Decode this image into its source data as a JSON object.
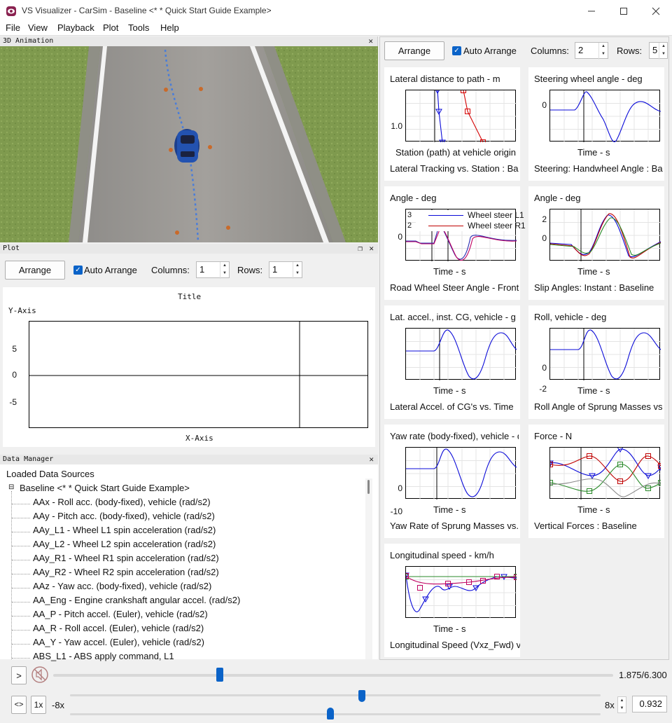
{
  "window": {
    "title": "VS Visualizer - CarSim - Baseline <* * Quick Start Guide Example>",
    "min_icon": "minimize-icon",
    "max_icon": "maximize-icon",
    "close_icon": "close-icon"
  },
  "menu": [
    "File",
    "View",
    "Playback",
    "Plot",
    "Tools",
    "Help"
  ],
  "animation_panel": {
    "header": "3D Animation",
    "close": "✕"
  },
  "plot_panel": {
    "header": "Plot",
    "arrange_label": "Arrange",
    "auto_arrange_label": "Auto Arrange",
    "columns_label": "Columns:",
    "columns_value": "1",
    "rows_label": "Rows:",
    "rows_value": "1",
    "chart_title": "Title",
    "y_axis_label": "Y-Axis",
    "x_axis_label": "X-Axis",
    "y_ticks": [
      "5",
      "0",
      "-5"
    ]
  },
  "data_manager": {
    "header": "Data Manager",
    "root": "Loaded Data Sources",
    "dataset": "Baseline <* * Quick Start Guide Example>",
    "items": [
      "AAx - Roll acc. (body-fixed), vehicle (rad/s2)",
      "AAy - Pitch acc. (body-fixed), vehicle (rad/s2)",
      "AAy_L1 - Wheel L1 spin acceleration (rad/s2)",
      "AAy_L2 - Wheel L2 spin acceleration (rad/s2)",
      "AAy_R1 - Wheel R1 spin acceleration (rad/s2)",
      "AAy_R2 - Wheel R2 spin acceleration (rad/s2)",
      "AAz - Yaw acc. (body-fixed), vehicle (rad/s2)",
      "AA_Eng - Engine crankshaft angular accel. (rad/s2)",
      "AA_P - Pitch accel. (Euler), vehicle (rad/s2)",
      "AA_R - Roll accel. (Euler), vehicle (rad/s2)",
      "AA_Y - Yaw accel. (Euler), vehicle (rad/s2)",
      "ABS_L1 - ABS apply command, L1"
    ]
  },
  "right_panel": {
    "arrange_label": "Arrange",
    "auto_arrange_label": "Auto Arrange",
    "columns_label": "Columns:",
    "columns_value": "2",
    "rows_label": "Rows:",
    "rows_value": "5"
  },
  "plots": [
    {
      "title": "Lateral distance to path - m",
      "xlabel": "Station (path) at vehicle origin",
      "desc": "Lateral Tracking vs. Station : Ba",
      "ticks": [
        "1.0"
      ]
    },
    {
      "title": "Steering wheel angle - deg",
      "xlabel": "Time - s",
      "desc": "Steering: Handwheel Angle : Ba",
      "ticks": [
        "0"
      ]
    },
    {
      "title": "Angle - deg",
      "xlabel": "Time - s",
      "desc": "Road Wheel Steer Angle - Front",
      "ticks": [
        "0"
      ],
      "legend": [
        "Wheel steer L1",
        "Wheel steer R1"
      ],
      "legend_nums": [
        "3",
        "2"
      ]
    },
    {
      "title": "Angle - deg",
      "xlabel": "Time - s",
      "desc": "Slip Angles: Instant : Baseline",
      "ticks": [
        "2",
        "0"
      ]
    },
    {
      "title": "Lat. accel., inst. CG, vehicle - g",
      "xlabel": "Time - s",
      "desc": "Lateral Accel. of CG's vs. Time",
      "ticks": []
    },
    {
      "title": "Roll, vehicle - deg",
      "xlabel": "Time - s",
      "desc": "Roll Angle of Sprung Masses vs",
      "ticks": [
        "0",
        "-2"
      ]
    },
    {
      "title": "Yaw rate (body-fixed), vehicle - deg/s",
      "xlabel": "Time - s",
      "desc": "Yaw Rate of Sprung Masses vs.",
      "ticks": [
        "0",
        "-10"
      ]
    },
    {
      "title": "Force - N",
      "xlabel": "Time - s",
      "desc": "Vertical Forces : Baseline",
      "ticks": []
    },
    {
      "title": "Longitudinal speed - km/h",
      "xlabel": "Time - s",
      "desc": "Longitudinal Speed (Vxz_Fwd) v",
      "ticks": []
    }
  ],
  "playback": {
    "play_label": ">",
    "time_display": "1.875/6.300",
    "time_fraction": 0.298,
    "loop_label": "<>",
    "speed_label": "1x",
    "speed_min": "-8x",
    "speed_max": "8x",
    "speed_value": "0.932",
    "speed_fraction": 0.55,
    "lower_fraction": 0.2
  }
}
